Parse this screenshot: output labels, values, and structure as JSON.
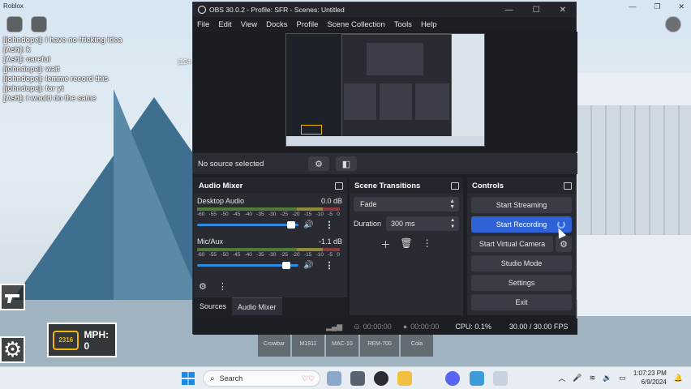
{
  "roblox": {
    "title": "Roblox",
    "chat": [
      {
        "user": "[johndope]:",
        "msg": "i have no fricking idea"
      },
      {
        "user": "[Ash]:",
        "msg": "k"
      },
      {
        "user": "[Ash]:",
        "msg": "careful"
      },
      {
        "user": "[johndope]:",
        "msg": "wait"
      },
      {
        "user": "[johndope]:",
        "msg": "lemme record this"
      },
      {
        "user": "[johndope]:",
        "msg": "for yt"
      },
      {
        "user": "[Ash]:",
        "msg": "i would do the same"
      }
    ],
    "chat_extra": "(124",
    "hud": {
      "engine_value": "2316",
      "mph_label": "MPH: 0"
    },
    "inventory": [
      "Crowbar",
      "M1911",
      "MAC-10",
      "REM-700",
      "Cola"
    ]
  },
  "obs": {
    "title": "OBS 30.0.2 - Profile: SFR - Scenes: Untitled",
    "menu": [
      "File",
      "Edit",
      "View",
      "Docks",
      "Profile",
      "Scene Collection",
      "Tools",
      "Help"
    ],
    "source_bar": {
      "label": "No source selected"
    },
    "audio_mixer": {
      "title": "Audio Mixer",
      "ticks": [
        "-60",
        "-55",
        "-50",
        "-45",
        "-40",
        "-35",
        "-30",
        "-25",
        "-20",
        "-15",
        "-10",
        "-5",
        "0"
      ],
      "channels": [
        {
          "name": "Desktop Audio",
          "db": "0.0 dB",
          "level": 0.97
        },
        {
          "name": "Mic/Aux",
          "db": "-1.1 dB",
          "level": 0.92
        }
      ]
    },
    "dock_tabs": [
      "Sources",
      "Audio Mixer"
    ],
    "scene_transitions": {
      "title": "Scene Transitions",
      "transition": "Fade",
      "duration_label": "Duration",
      "duration_value": "300 ms"
    },
    "controls": {
      "title": "Controls",
      "start_streaming": "Start Streaming",
      "start_recording": "Start Recording",
      "start_virtual_camera": "Start Virtual Camera",
      "studio_mode": "Studio Mode",
      "settings": "Settings",
      "exit": "Exit"
    },
    "status": {
      "stream_time": "00:00:00",
      "rec_time": "00:00:00",
      "cpu": "CPU: 0.1%",
      "fps": "30.00 / 30.00 FPS"
    }
  },
  "taskbar": {
    "search_placeholder": "Search",
    "time": "1:07:23 PM",
    "date": "6/9/2024"
  },
  "colors": {
    "accent": "#2f62d6",
    "obs_bg": "#1e1f25",
    "hud_engine": "#f2b50c"
  }
}
